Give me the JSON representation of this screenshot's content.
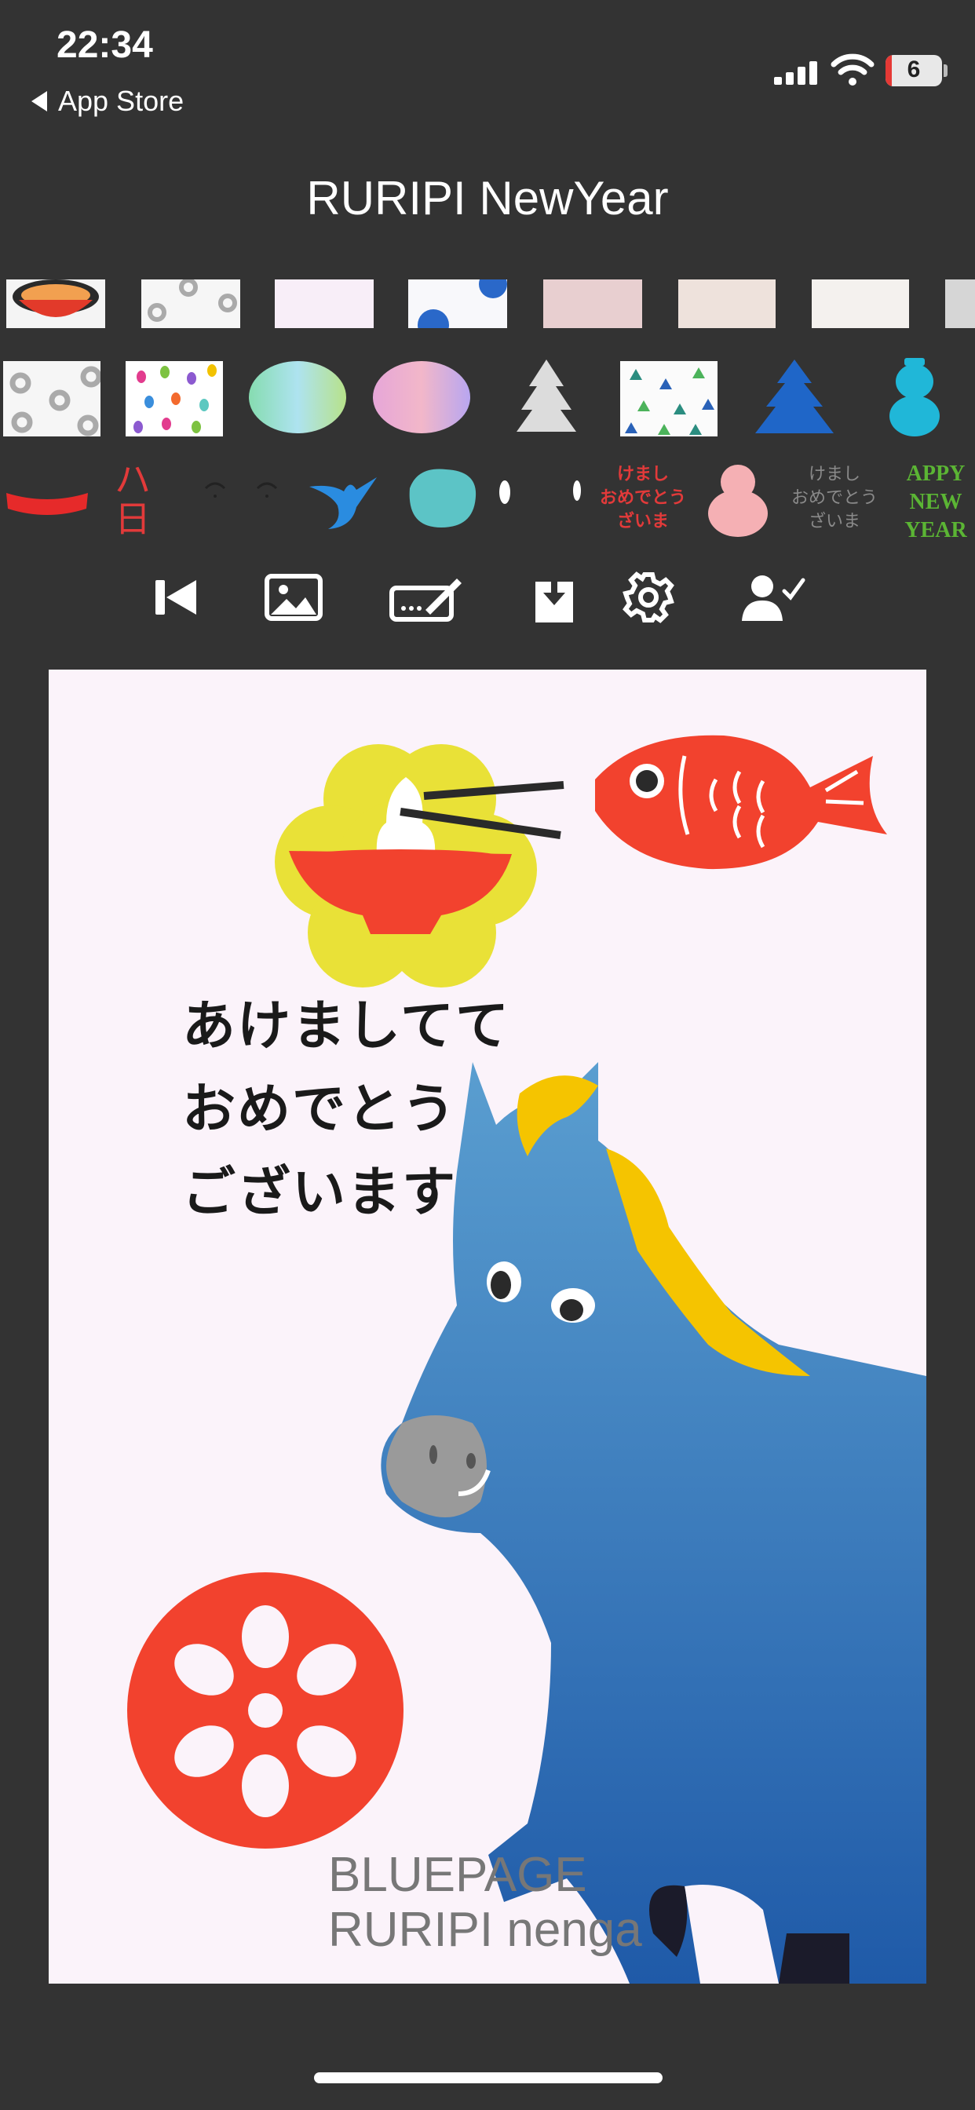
{
  "status_bar": {
    "time": "22:34",
    "back_label": "App Store",
    "battery": "6"
  },
  "header": {
    "title": "RURIPI NewYear"
  },
  "stamps_row3": {
    "sticker_kanji": "ハ日",
    "text_red": [
      "けまし",
      "おめでとう",
      "ざいま"
    ],
    "text_grey": [
      "けまし",
      "おめでとう",
      "ざいま"
    ],
    "text_green": [
      "APPY",
      "NEW",
      "YEAR"
    ]
  },
  "toolbar": {
    "icons": [
      "skip-back-icon",
      "image-icon",
      "signature-icon",
      "download-icon",
      "gear-icon",
      "user-check-icon"
    ]
  },
  "card": {
    "greeting": [
      "あけましてて",
      "おめでとう",
      "ございます"
    ],
    "watermark": [
      "BLUEPAGE",
      "RURIPI nenga"
    ]
  },
  "colors": {
    "background": "#333333",
    "card": "#fbf3fa",
    "red": "#f2422e",
    "yellow": "#e9e137",
    "horse_blue": "#3f86c0",
    "mane": "#f5c400",
    "muzzle": "#9a9a9a"
  }
}
